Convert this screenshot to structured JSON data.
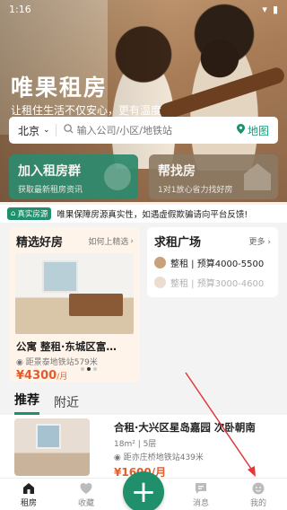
{
  "status_bar": {
    "time": "1:16",
    "battery": "◼"
  },
  "hero": {
    "title": "唯果租房",
    "slogan": "让租住生活不仅安心，更有温度"
  },
  "search": {
    "city": "北京",
    "placeholder": "输入公司/小区/地铁站",
    "map_label": "地图"
  },
  "cards": [
    {
      "title": "加入租房群",
      "subtitle": "获取最新租房资讯"
    },
    {
      "title": "帮找房",
      "subtitle": "1对1放心省力找好房"
    }
  ],
  "notice": {
    "tag": "真实房源",
    "text": "唯果保障房源真实性，如遇虚假欺骗请向平台反馈!"
  },
  "featured": {
    "title": "精选好房",
    "help": "如何上精选",
    "listing_title": "公寓 整租·东城区富…",
    "location": "距景泰地铁站579米",
    "price": "¥4300",
    "price_unit": "/月"
  },
  "square": {
    "title": "求租广场",
    "more": "更多",
    "rows": [
      {
        "text": "整租 | 预算4000-5500"
      },
      {
        "text": "整租 | 预算3000-4600"
      }
    ]
  },
  "tabs": [
    "推荐",
    "附近"
  ],
  "listing": {
    "title": "合租·大兴区星岛嘉园 次卧朝南",
    "sub": "18m² | 5层",
    "location": "距亦庄桥地铁站439米",
    "price": "¥1600/月"
  },
  "bottom_nav": [
    {
      "label": "租房",
      "icon": "home-icon"
    },
    {
      "label": "收藏",
      "icon": "heart-icon"
    },
    {
      "label": "",
      "icon": "plus-icon"
    },
    {
      "label": "消息",
      "icon": "message-icon"
    },
    {
      "label": "我的",
      "icon": "profile-icon"
    }
  ],
  "colors": {
    "brand": "#1f8f6c",
    "price": "#e45b2c",
    "annotation": "#e0393c"
  }
}
